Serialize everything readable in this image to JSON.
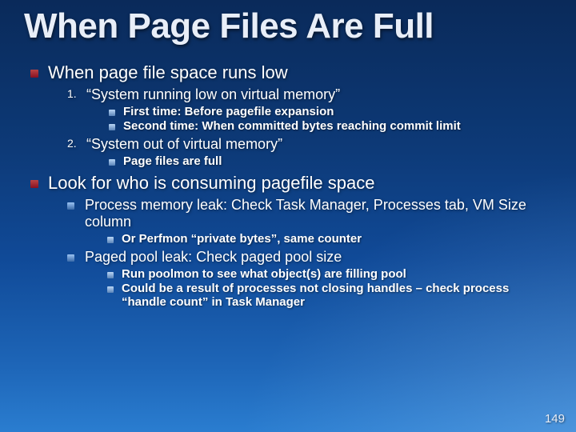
{
  "title": "When Page Files Are Full",
  "page_number": "149",
  "bullets": [
    {
      "text": "When page file space runs low",
      "numbered": [
        {
          "ord": "1.",
          "text": "“System running low on virtual memory”",
          "sub": [
            "First time:  Before pagefile expansion",
            "Second time:  When committed bytes reaching commit limit"
          ]
        },
        {
          "ord": "2.",
          "text": "“System out of virtual memory”",
          "sub": [
            "Page files are full"
          ]
        }
      ]
    },
    {
      "text": "Look for who is consuming pagefile space",
      "sub": [
        {
          "text": "Process memory leak:  Check Task Manager, Processes tab, VM Size column",
          "sub": [
            "Or Perfmon “private bytes”, same counter"
          ]
        },
        {
          "text": "Paged pool leak:  Check paged pool size",
          "sub": [
            "Run poolmon to see what object(s) are filling pool",
            "Could be a result of processes not closing handles – check process “handle count” in Task Manager"
          ]
        }
      ]
    }
  ]
}
